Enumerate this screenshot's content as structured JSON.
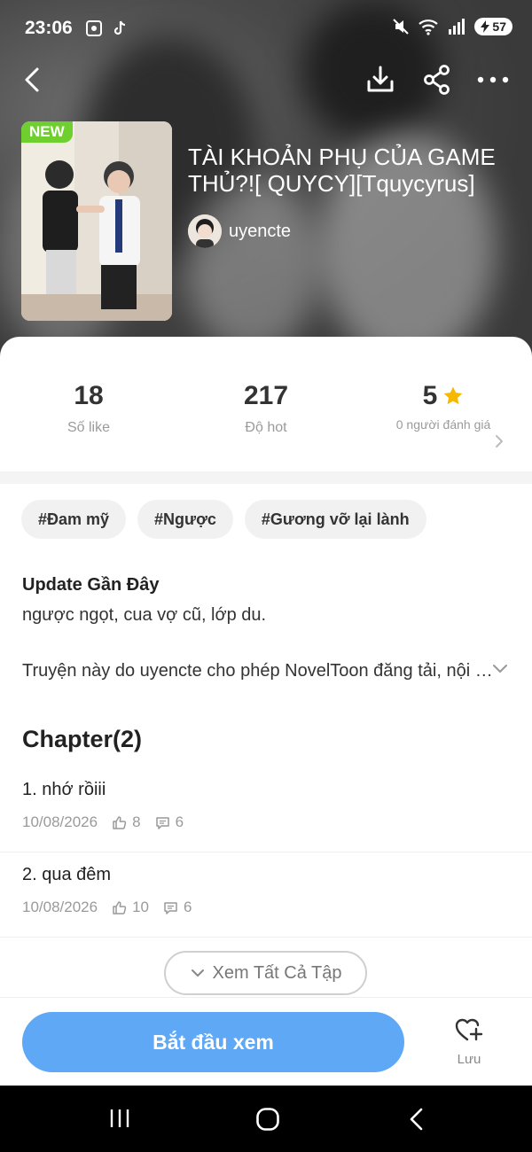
{
  "status_bar": {
    "time": "23:06",
    "battery": "57"
  },
  "book": {
    "badge": "NEW",
    "title": "TÀI KHOẢN PHỤ CỦA GAME THỦ?![ QUYCY][Tquycyrus]",
    "author": "uyencte"
  },
  "stats": {
    "likes_value": "18",
    "likes_label": "Số like",
    "hot_value": "217",
    "hot_label": "Độ hot",
    "rating_value": "5",
    "rating_label": "0 người đánh giá"
  },
  "tags": [
    "#Đam mỹ",
    "#Ngược",
    "#Gương vỡ lại lành"
  ],
  "update": {
    "heading": "Update Gần Đây",
    "text": "ngược ngọt, cua vợ cũ, lớp du."
  },
  "copyright_text": "Truyện này do uyencte cho phép NovelToon đăng tải, nội dung chỉ đại diện cho quan điểm của tác giả",
  "chapters": {
    "heading": "Chapter(2)",
    "items": [
      {
        "title": "1. nhớ rồiii",
        "date": "10/08/2026",
        "likes": "8",
        "comments": "6"
      },
      {
        "title": "2. qua đêm",
        "date": "10/08/2026",
        "likes": "10",
        "comments": "6"
      }
    ],
    "see_all_label": "Xem Tất Cả Tập"
  },
  "bottom": {
    "start_label": "Bắt đầu xem",
    "save_label": "Lưu"
  },
  "colors": {
    "accent": "#5ea8f5",
    "badge": "#6fcf2f",
    "star": "#f5b900"
  }
}
